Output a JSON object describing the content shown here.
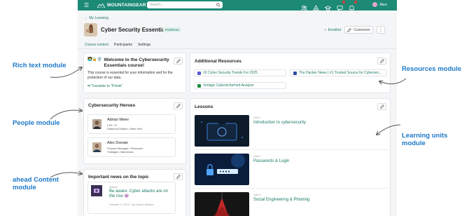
{
  "callouts": {
    "rich_text": "Rich text module",
    "people": "People module",
    "ahead_content_line1": "ahead Content",
    "ahead_content_line2": "module",
    "resources": "Resources module",
    "learning_units_line1": "Learning units",
    "learning_units_line2": "module"
  },
  "topbar": {
    "brand": "MOUNTAINGEAR",
    "search_placeholder": "Search...",
    "user_name": "Alex",
    "color": "#1d8a76"
  },
  "breadcrumb": "My Learning",
  "course": {
    "title": "Cyber Security Essentials",
    "status": "Published",
    "enrolled": "Enrolled",
    "customize": "Customize",
    "more": "⋮"
  },
  "tabs": [
    "Course content",
    "Participants",
    "Settings"
  ],
  "rich_text": {
    "title": "Welcome to the Cybersecurity Essentials course!",
    "body": "This course is essential for your information and for the protection of our data.",
    "translate": "Translate to \"Polski\""
  },
  "people": {
    "title": "Cybersecurity Heroes",
    "items": [
      {
        "name": "Adrian Meier",
        "role": "CIO • IT",
        "location": "Diamond District • New York"
      },
      {
        "name": "Alex Donate",
        "role": "Product Manager • Research",
        "location": "Trafalgar • Barcelona"
      }
    ]
  },
  "news": {
    "title": "Important news on the topic",
    "meta": "Ahead",
    "item_title": "Be aware: Cyber attacks are on the rise 👾",
    "date": "October 3, 2023 · By Daniel Winkler"
  },
  "resources": {
    "title": "Additional Resources",
    "links": [
      {
        "label": "10 Cyber Security Trends For 2025",
        "color": "#5b5bd6"
      },
      {
        "label": "The Hacker News | #1 Trusted Source for Cybersec...",
        "color": "#2d4ea3"
      },
      {
        "label": "Vorlage Cybersicherheit-Analyse",
        "color": "#1e8e3e"
      }
    ]
  },
  "lessons": {
    "title": "Lessons",
    "units": [
      {
        "label": "Unit 1",
        "title": "Introduction to cybersecurity"
      },
      {
        "label": "Unit 2",
        "title": "Passwords & Login"
      },
      {
        "label": "Unit 3",
        "title": "Social Engineering & Phishing"
      }
    ]
  }
}
